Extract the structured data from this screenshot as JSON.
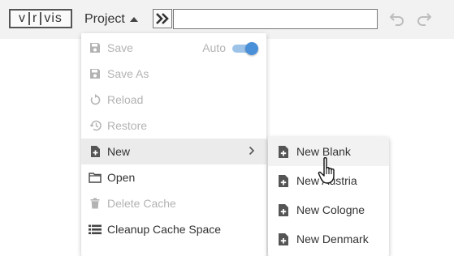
{
  "toolbar": {
    "logo_text": [
      "v",
      "r",
      "vis"
    ],
    "project_label": "Project",
    "command_input_value": "",
    "icons": [
      "chevron-double-right-icon",
      "undo-icon",
      "redo-icon"
    ]
  },
  "menu": {
    "items": [
      {
        "label": "Save",
        "icon": "save-icon",
        "disabled": true
      },
      {
        "label": "Save As",
        "icon": "save-as-icon",
        "disabled": true
      },
      {
        "label": "Reload",
        "icon": "reload-icon",
        "disabled": true
      },
      {
        "label": "Restore",
        "icon": "restore-icon",
        "disabled": true
      },
      {
        "label": "New",
        "icon": "new-file-icon",
        "disabled": false,
        "active": true,
        "has_submenu": true
      },
      {
        "label": "Open",
        "icon": "folder-icon",
        "disabled": false
      },
      {
        "label": "Delete Cache",
        "icon": "trash-icon",
        "disabled": true
      },
      {
        "label": "Cleanup Cache Space",
        "icon": "list-icon",
        "disabled": false
      }
    ],
    "auto_label": "Auto",
    "auto_enabled": true
  },
  "submenu": {
    "items": [
      {
        "label": "New Blank",
        "icon": "new-file-icon"
      },
      {
        "label": "New Austria",
        "icon": "new-file-icon"
      },
      {
        "label": "New Cologne",
        "icon": "new-file-icon"
      },
      {
        "label": "New Denmark",
        "icon": "new-file-icon"
      }
    ]
  },
  "colors": {
    "toolbar_bg": "#f2f2f2",
    "toggle_accent": "#4a90d9",
    "disabled_text": "#b3b3b3",
    "active_row": "#ebebeb"
  }
}
